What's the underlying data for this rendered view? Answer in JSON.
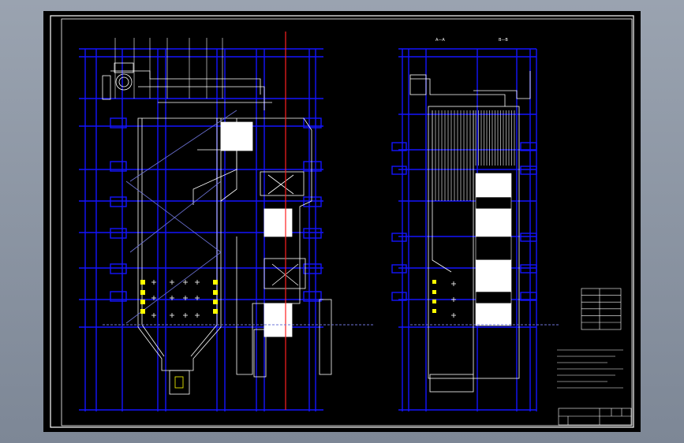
{
  "viewer": {
    "background_top": "#9aa3b0",
    "background_bottom": "#7d8796",
    "sheet_color": "#000000"
  },
  "drawing": {
    "frame_color": "#ffffff",
    "structure_color": "#1414ff",
    "detail_color": "#ffffff",
    "centerline_color": "#ff2020",
    "accent_color": "#ffff00",
    "platform_color": "#6e74d8"
  },
  "section_labels": {
    "left_view": "",
    "right_view": "",
    "right_view_cut_1": "A—A",
    "right_view_cut_2": "B—B"
  },
  "parameter_table": {
    "title": "",
    "rows": [
      [
        "",
        ""
      ],
      [
        "",
        ""
      ],
      [
        "",
        ""
      ],
      [
        "",
        ""
      ],
      [
        "",
        ""
      ],
      [
        "",
        ""
      ]
    ]
  },
  "notes": {
    "heading": "",
    "lines": [
      "",
      "",
      "",
      "",
      ""
    ]
  },
  "title_block": {
    "drawing_title": "",
    "cells": [
      "",
      "",
      "",
      ""
    ]
  }
}
